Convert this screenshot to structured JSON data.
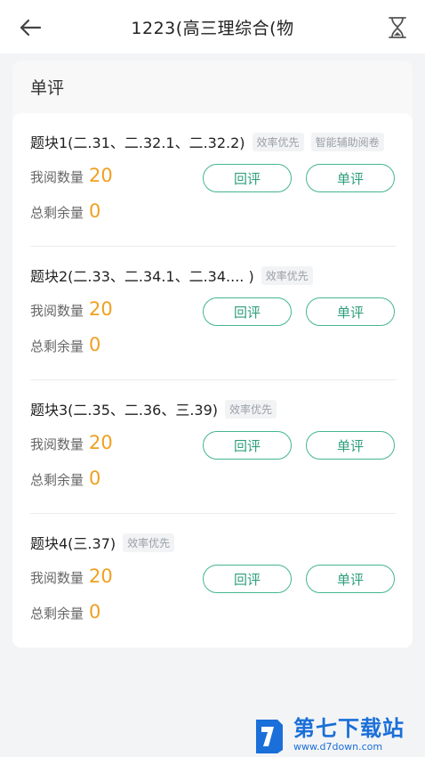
{
  "header": {
    "title": "1223(高三理综合(物",
    "back_icon": "arrow-left-icon",
    "timer_icon": "hourglass-icon"
  },
  "section": {
    "title": "单评"
  },
  "blocks": [
    {
      "title": "题块1(二.31、二.32.1、二.32.2)",
      "tags": [
        "效率优先",
        "智能辅助阅卷"
      ],
      "read_label": "我阅数量",
      "read_value": "20",
      "remain_label": "总剩余量",
      "remain_value": "0",
      "review_label": "回评",
      "single_label": "单评"
    },
    {
      "title": "题块2(二.33、二.34.1、二.34.... )",
      "tags": [
        "效率优先"
      ],
      "read_label": "我阅数量",
      "read_value": "20",
      "remain_label": "总剩余量",
      "remain_value": "0",
      "review_label": "回评",
      "single_label": "单评"
    },
    {
      "title": "题块3(二.35、二.36、三.39)",
      "tags": [
        "效率优先"
      ],
      "read_label": "我阅数量",
      "read_value": "20",
      "remain_label": "总剩余量",
      "remain_value": "0",
      "review_label": "回评",
      "single_label": "单评"
    },
    {
      "title": "题块4(三.37)",
      "tags": [
        "效率优先"
      ],
      "read_label": "我阅数量",
      "read_value": "20",
      "remain_label": "总剩余量",
      "remain_value": "0",
      "review_label": "回评",
      "single_label": "单评"
    }
  ],
  "watermark": {
    "name": "第七下载站",
    "url": "www.d7down.com"
  },
  "colors": {
    "accent": "#43b591",
    "value": "#f0a020",
    "watermark": "#1a6fd8"
  }
}
